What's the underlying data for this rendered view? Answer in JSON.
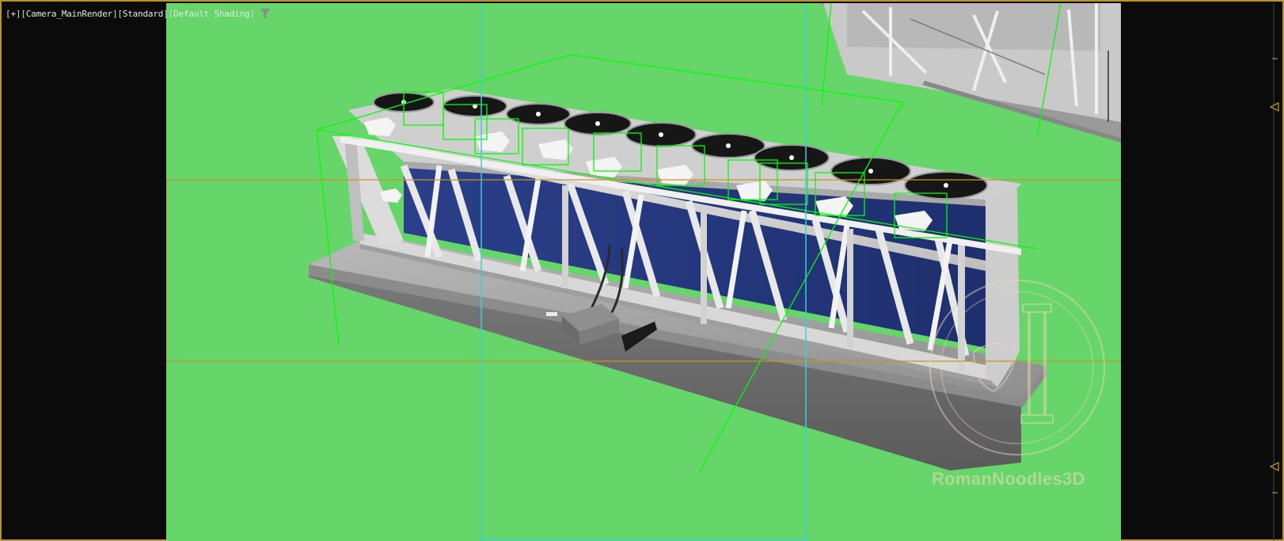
{
  "viewport": {
    "label_parts": [
      "[",
      "+",
      "]",
      "[",
      "Camera_MainRender",
      "]",
      "[",
      "Standard",
      "]",
      "[",
      "Default Shading",
      "]"
    ],
    "point_of_view": "Camera_MainRender",
    "render_mode": "Standard",
    "shading": "Default Shading",
    "filter_icon": "funnel-icon",
    "background_color": "#66d66b",
    "border_color": "#b8942a",
    "safe_frame_color": "#c8922a",
    "selection_color": "#00ff00",
    "guide_color": "#3ccfd6"
  },
  "watermark": {
    "text": "RomanNoodles3D",
    "logo": "column-emblem-icon"
  }
}
